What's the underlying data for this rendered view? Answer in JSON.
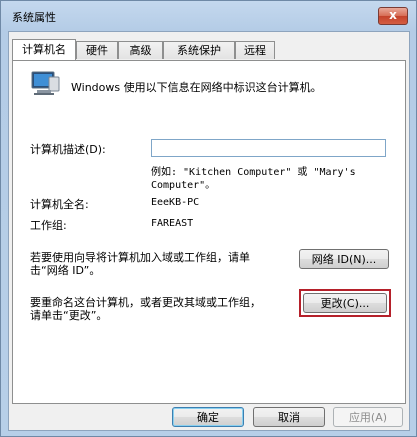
{
  "window": {
    "title": "系统属性",
    "close_label": "x"
  },
  "tabs": [
    {
      "label": "计算机名"
    },
    {
      "label": "硬件"
    },
    {
      "label": "高级"
    },
    {
      "label": "系统保护"
    },
    {
      "label": "远程"
    }
  ],
  "intro": "Windows 使用以下信息在网络中标识这台计算机。",
  "description": {
    "label": "计算机描述(D):",
    "value": "",
    "example_line1": "例如: \"Kitchen Computer\" 或 \"Mary's",
    "example_line2": "Computer\"。"
  },
  "full_name": {
    "label": "计算机全名:",
    "value": "EeeKB-PC"
  },
  "workgroup": {
    "label": "工作组:",
    "value": "FAREAST"
  },
  "network_id": {
    "text_line1": "若要使用向导将计算机加入域或工作组，请单",
    "text_line2": "击“网络 ID”。",
    "button": "网络 ID(N)..."
  },
  "rename": {
    "text_line1": "要重命名这台计算机，或者更改其域或工作组，",
    "text_line2": "请单击“更改”。",
    "button": "更改(C)..."
  },
  "footer": {
    "ok": "确定",
    "cancel": "取消",
    "apply": "应用(A)"
  }
}
